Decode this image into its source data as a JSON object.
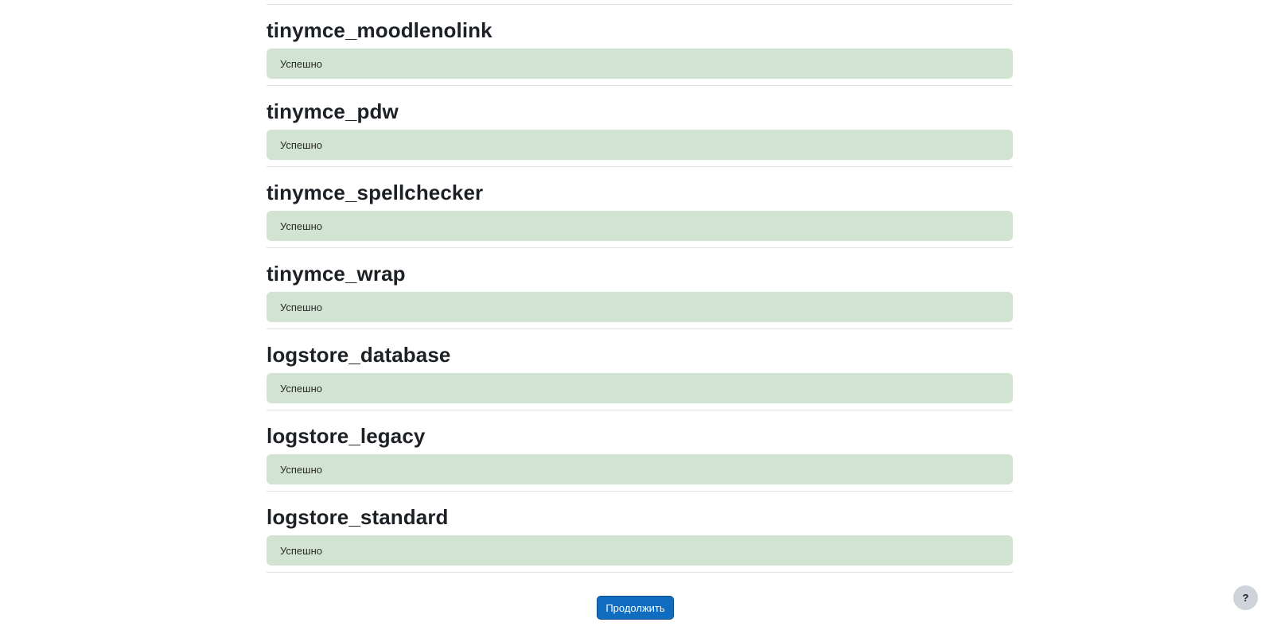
{
  "sections": [
    {
      "title": "tinymce_moodlenolink",
      "status": "Успешно"
    },
    {
      "title": "tinymce_pdw",
      "status": "Успешно"
    },
    {
      "title": "tinymce_spellchecker",
      "status": "Успешно"
    },
    {
      "title": "tinymce_wrap",
      "status": "Успешно"
    },
    {
      "title": "logstore_database",
      "status": "Успешно"
    },
    {
      "title": "logstore_legacy",
      "status": "Успешно"
    },
    {
      "title": "logstore_standard",
      "status": "Успешно"
    }
  ],
  "continue_label": "Продолжить",
  "help": {
    "label": "?",
    "icon": "question-icon"
  },
  "colors": {
    "success_bg": "#d2e3d1",
    "primary": "#0f6cbf",
    "help_bg": "#ced4da"
  }
}
